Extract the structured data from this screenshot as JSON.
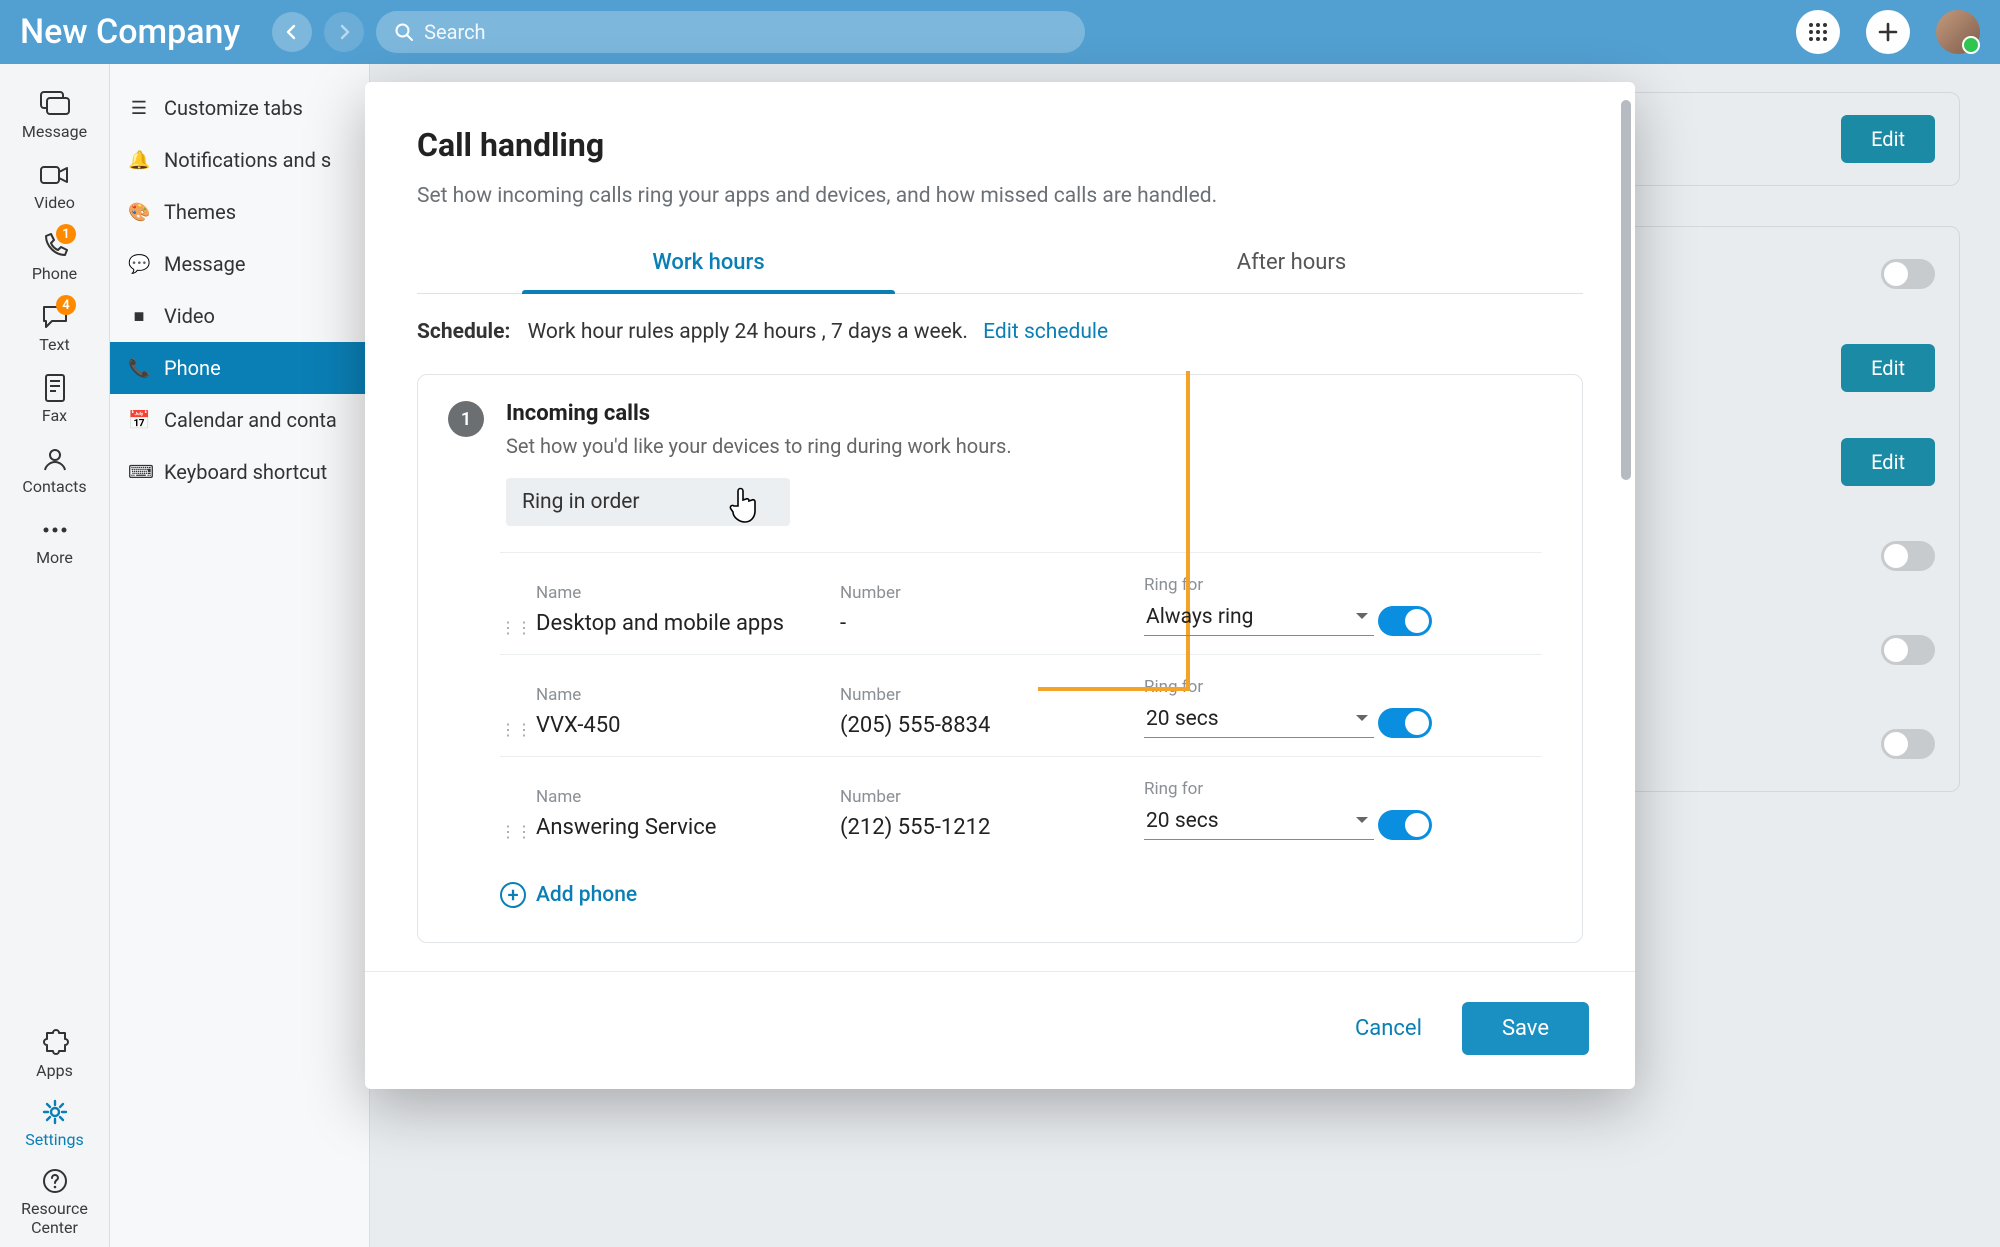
{
  "topbar": {
    "title": "New Company",
    "search_placeholder": "Search"
  },
  "rail": {
    "items": [
      {
        "label": "Message",
        "badge": null
      },
      {
        "label": "Video",
        "badge": null
      },
      {
        "label": "Phone",
        "badge": "1"
      },
      {
        "label": "Text",
        "badge": "4"
      },
      {
        "label": "Fax",
        "badge": null
      },
      {
        "label": "Contacts",
        "badge": null
      },
      {
        "label": "More",
        "badge": null
      }
    ],
    "apps": "Apps",
    "settings": "Settings",
    "resource": "Resource Center"
  },
  "sidebar": {
    "items": [
      {
        "label": "Customize tabs"
      },
      {
        "label": "Notifications and s"
      },
      {
        "label": "Themes"
      },
      {
        "label": "Message"
      },
      {
        "label": "Video"
      },
      {
        "label": "Phone"
      },
      {
        "label": "Calendar and conta"
      },
      {
        "label": "Keyboard shortcut"
      }
    ]
  },
  "bg_buttons": {
    "edit": "Edit"
  },
  "modal": {
    "title": "Call handling",
    "subtitle": "Set how incoming calls ring your apps and devices, and how missed calls are handled.",
    "tabs": {
      "work": "Work hours",
      "after": "After hours"
    },
    "schedule": {
      "label": "Schedule:",
      "text": "Work hour rules apply 24 hours , 7 days a week.",
      "link": "Edit schedule"
    },
    "step": {
      "num": "1",
      "title": "Incoming calls",
      "desc": "Set how you'd like your devices to ring during work hours."
    },
    "ring_mode": "Ring in order",
    "cols": {
      "name": "Name",
      "number": "Number",
      "ringfor": "Ring for"
    },
    "devices": [
      {
        "name": "Desktop and mobile apps",
        "number": "-",
        "ringfor": "Always ring",
        "enabled": true
      },
      {
        "name": "VVX-450",
        "number": "(205) 555-8834",
        "ringfor": "20 secs",
        "enabled": true
      },
      {
        "name": "Answering Service",
        "number": "(212) 555-1212",
        "ringfor": "20 secs",
        "enabled": true
      }
    ],
    "add_phone": "Add phone",
    "cancel": "Cancel",
    "save": "Save"
  }
}
